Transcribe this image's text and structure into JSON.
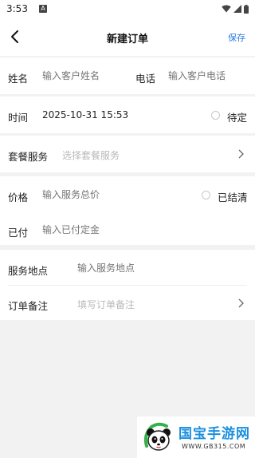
{
  "status_bar": {
    "time": "3:53",
    "notification_icon": "a-notification-icon",
    "icons": [
      "wifi-icon",
      "signal-icon",
      "battery-icon"
    ]
  },
  "header": {
    "title": "新建订单",
    "save_label": "保存",
    "back_icon": "chevron-left-icon"
  },
  "customer": {
    "name_label": "姓名",
    "name_placeholder": "输入客户姓名",
    "phone_label": "电话",
    "phone_placeholder": "输入客户电话"
  },
  "schedule": {
    "time_label": "时间",
    "time_value": "2025-10-31 15:53",
    "pending_label": "待定",
    "pending_checked": false
  },
  "package": {
    "label": "套餐服务",
    "placeholder": "选择套餐服务"
  },
  "payment": {
    "price_label": "价格",
    "price_placeholder": "输入服务总价",
    "settled_label": "已结清",
    "settled_checked": false,
    "paid_label": "已付",
    "paid_placeholder": "输入已付定金"
  },
  "location": {
    "address_label": "服务地点",
    "address_placeholder": "输入服务地点",
    "note_label": "订单备注",
    "note_placeholder": "填写订单备注"
  },
  "watermark": {
    "brand": "国宝手游网",
    "url": "WWW.GB315.COM"
  },
  "colors": {
    "accent": "#2f7de1",
    "background": "#f2f2f2",
    "watermark_blue": "#1a8fe0"
  }
}
